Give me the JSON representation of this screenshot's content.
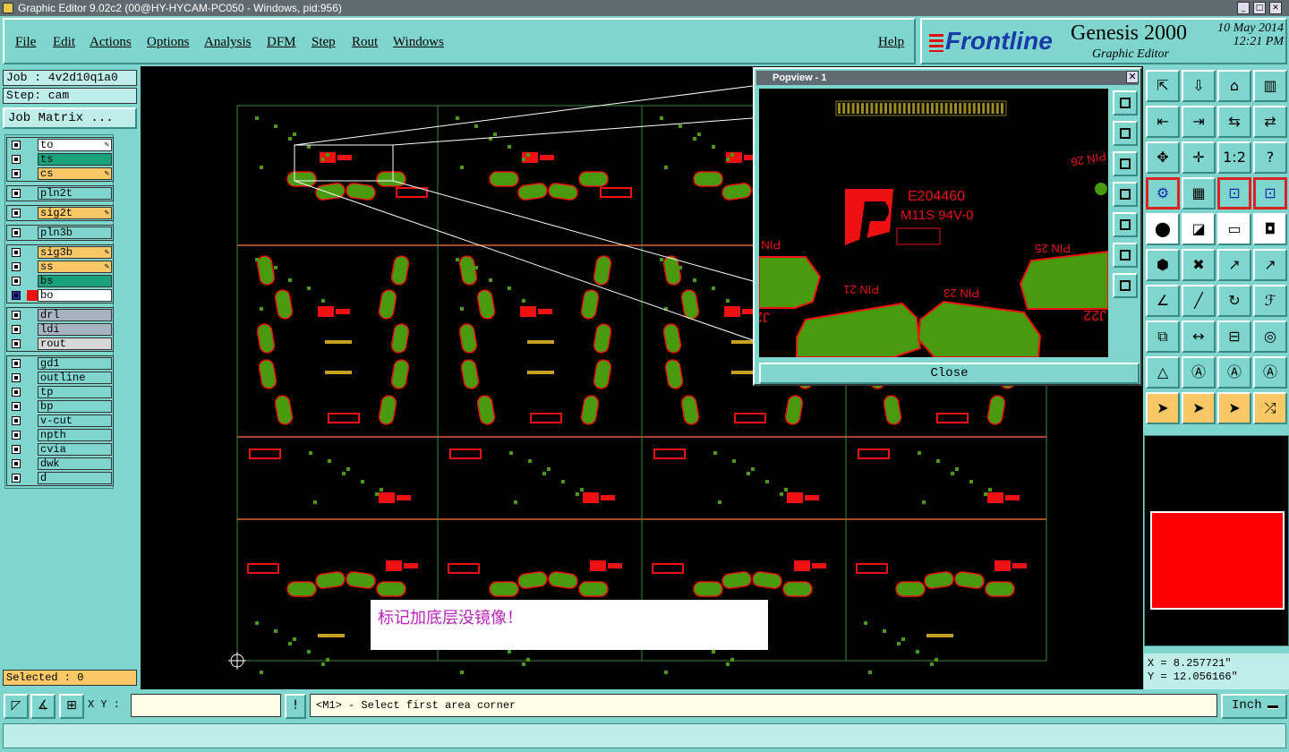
{
  "window": {
    "title": "Graphic Editor 9.02c2 (00@HY-HYCAM-PC050 - Windows, pid:956)"
  },
  "menu": [
    "File",
    "Edit",
    "Actions",
    "Options",
    "Analysis",
    "DFM",
    "Step",
    "Rout",
    "Windows"
  ],
  "help": "Help",
  "brand": {
    "logo": "Frontline",
    "product": "Genesis 2000",
    "subtitle": "Graphic Editor",
    "date": "10 May 2014",
    "time": "12:21 PM"
  },
  "job": {
    "job_label": "Job : 4v2d10q1a0",
    "step_label": "Step: cam",
    "matrix_button": "Job Matrix ..."
  },
  "layers": [
    {
      "name": "to",
      "color": "#ffffff",
      "editable": true
    },
    {
      "name": "ts",
      "color": "#1aa37a",
      "editable": false
    },
    {
      "name": "cs",
      "color": "#f8c866",
      "editable": true
    },
    {
      "name": "pln2t",
      "color": "#7fd6cf",
      "editable": false
    },
    {
      "name": "sig2t",
      "color": "#f8c866",
      "editable": true
    },
    {
      "name": "pln3b",
      "color": "#7fd6cf",
      "editable": false
    },
    {
      "name": "sig3b",
      "color": "#f8c866",
      "editable": true
    },
    {
      "name": "ss",
      "color": "#f8c866",
      "editable": true
    },
    {
      "name": "bs",
      "color": "#1aa37a",
      "editable": false
    },
    {
      "name": "bo",
      "color": "#ffffff",
      "editable": false
    },
    {
      "name": "drl",
      "color": "#a9b4c2",
      "editable": false
    },
    {
      "name": "ldi",
      "color": "#a9b4c2",
      "editable": false
    },
    {
      "name": "rout",
      "color": "#d8d8d8",
      "editable": false
    },
    {
      "name": "gd1",
      "color": "#7fd6cf",
      "editable": false
    },
    {
      "name": "outline",
      "color": "#7fd6cf",
      "editable": false
    },
    {
      "name": "tp",
      "color": "#7fd6cf",
      "editable": false
    },
    {
      "name": "bp",
      "color": "#7fd6cf",
      "editable": false
    },
    {
      "name": "v-cut",
      "color": "#7fd6cf",
      "editable": false
    },
    {
      "name": "npth",
      "color": "#7fd6cf",
      "editable": false
    },
    {
      "name": "cvia",
      "color": "#7fd6cf",
      "editable": false
    },
    {
      "name": "dwk",
      "color": "#7fd6cf",
      "editable": false
    },
    {
      "name": "d",
      "color": "#7fd6cf",
      "editable": false
    }
  ],
  "selected": "Selected : 0",
  "popview": {
    "title": "Popview - 1",
    "close_label": "Close",
    "texts": {
      "ul": "E204460",
      "ul2": "M11S 94V-0",
      "pin15": "PIN 15",
      "pin21": "PIN 21",
      "pin23": "PIN 23",
      "pin25": "PIN 25",
      "pin26": "PIN 26",
      "j22": "J22"
    }
  },
  "annotation": "标记加底层没镜像！",
  "coords": {
    "x": "X = 8.257721\"",
    "y": "Y = 12.056166\""
  },
  "bottom": {
    "xy_label": "X Y :",
    "xy_value": "",
    "prompt": "<M1> - Select first area corner",
    "unit": "Inch"
  },
  "colors": {
    "pad_green": "#4a9a10",
    "copper_red": "#ee1111",
    "grid_orange": "#e06030",
    "panel_bg": "#7fd6cf"
  }
}
